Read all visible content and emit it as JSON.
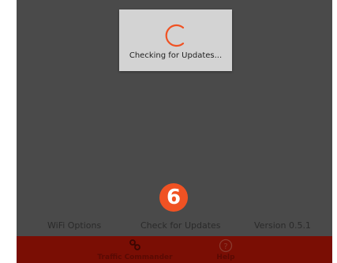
{
  "dialog": {
    "message": "Checking for Updates..."
  },
  "footer": {
    "wifi_label": "WiFi Options",
    "check_label": "Check for Updates",
    "version_label": "Version 0.5.1"
  },
  "nav": {
    "traffic_commander_label": "Traffic Commander",
    "help_label": "Help"
  },
  "annotation": {
    "step_number": "6"
  },
  "colors": {
    "screen_bg": "#4a4a4a",
    "nav_bg": "#7a0e04",
    "accent": "#f05223",
    "dialog_bg": "#d3d3d3"
  }
}
